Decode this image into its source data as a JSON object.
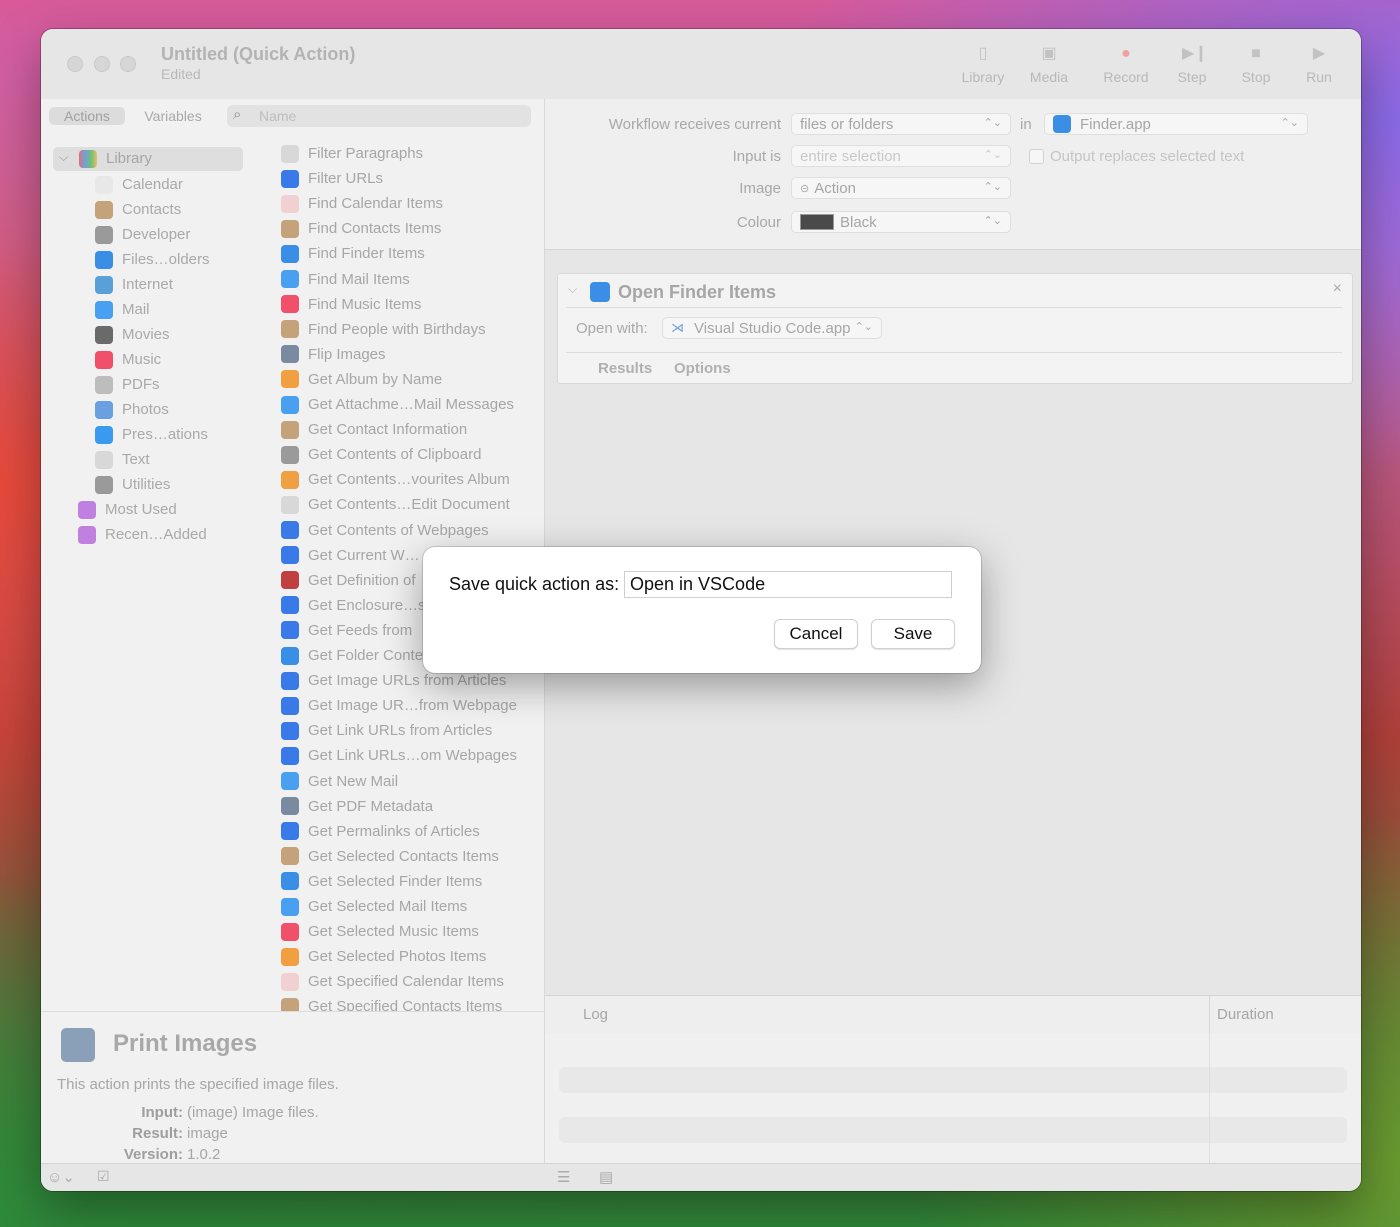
{
  "window": {
    "title": "Untitled (Quick Action)",
    "subtitle": "Edited"
  },
  "toolbar": {
    "items": [
      {
        "label": "Library",
        "icon": "library-icon"
      },
      {
        "label": "Media",
        "icon": "media-icon"
      },
      {
        "label": "Record",
        "icon": "record-icon"
      },
      {
        "label": "Step",
        "icon": "step-icon"
      },
      {
        "label": "Stop",
        "icon": "stop-icon"
      },
      {
        "label": "Run",
        "icon": "run-icon"
      }
    ]
  },
  "left": {
    "tabs": [
      "Actions",
      "Variables"
    ],
    "search_placeholder": "Name",
    "library_label": "Library",
    "library": [
      {
        "label": "Calendar",
        "color": "#e8e8e8"
      },
      {
        "label": "Contacts",
        "color": "#c4a27a"
      },
      {
        "label": "Developer",
        "color": "#9a9a9a"
      },
      {
        "label": "Files…olders",
        "color": "#3a8ee6"
      },
      {
        "label": "Internet",
        "color": "#5aa0d8"
      },
      {
        "label": "Mail",
        "color": "#4aa0f0"
      },
      {
        "label": "Movies",
        "color": "#6a6a6a"
      },
      {
        "label": "Music",
        "color": "#f0506a"
      },
      {
        "label": "PDFs",
        "color": "#bdbdbd"
      },
      {
        "label": "Photos",
        "color": "#6aa0e0"
      },
      {
        "label": "Pres…ations",
        "color": "#3a9af0"
      },
      {
        "label": "Text",
        "color": "#d8d8d8"
      },
      {
        "label": "Utilities",
        "color": "#9a9a9a"
      }
    ],
    "smart": [
      {
        "label": "Most Used",
        "color": "#c080e0"
      },
      {
        "label": "Recen…Added",
        "color": "#c080e0"
      }
    ],
    "actions": [
      {
        "label": "Filter Paragraphs",
        "color": "#d8d8d8"
      },
      {
        "label": "Filter URLs",
        "color": "#3a7ae8"
      },
      {
        "label": "Find Calendar Items",
        "color": "#f0d0d0"
      },
      {
        "label": "Find Contacts Items",
        "color": "#c4a27a"
      },
      {
        "label": "Find Finder Items",
        "color": "#3a8ee6"
      },
      {
        "label": "Find Mail Items",
        "color": "#4aa0f0"
      },
      {
        "label": "Find Music Items",
        "color": "#f0506a"
      },
      {
        "label": "Find People with Birthdays",
        "color": "#c4a27a"
      },
      {
        "label": "Flip Images",
        "color": "#7a8aa0"
      },
      {
        "label": "Get Album by Name",
        "color": "#f0a040"
      },
      {
        "label": "Get Attachme…Mail Messages",
        "color": "#4aa0f0"
      },
      {
        "label": "Get Contact Information",
        "color": "#c4a27a"
      },
      {
        "label": "Get Contents of Clipboard",
        "color": "#9a9a9a"
      },
      {
        "label": "Get Contents…vourites Album",
        "color": "#f0a040"
      },
      {
        "label": "Get Contents…Edit Document",
        "color": "#d8d8d8"
      },
      {
        "label": "Get Contents of Webpages",
        "color": "#3a7ae8"
      },
      {
        "label": "Get Current W…",
        "color": "#3a7ae8"
      },
      {
        "label": "Get Definition of",
        "color": "#c04040"
      },
      {
        "label": "Get Enclosure…s",
        "color": "#3a7ae8"
      },
      {
        "label": "Get Feeds from",
        "color": "#3a7ae8"
      },
      {
        "label": "Get Folder Conte",
        "color": "#3a8ee6"
      },
      {
        "label": "Get Image URLs from Articles",
        "color": "#3a7ae8"
      },
      {
        "label": "Get Image UR…from Webpage",
        "color": "#3a7ae8"
      },
      {
        "label": "Get Link URLs from Articles",
        "color": "#3a7ae8"
      },
      {
        "label": "Get Link URLs…om Webpages",
        "color": "#3a7ae8"
      },
      {
        "label": "Get New Mail",
        "color": "#4aa0f0"
      },
      {
        "label": "Get PDF Metadata",
        "color": "#7a8aa0"
      },
      {
        "label": "Get Permalinks of Articles",
        "color": "#3a7ae8"
      },
      {
        "label": "Get Selected Contacts Items",
        "color": "#c4a27a"
      },
      {
        "label": "Get Selected Finder Items",
        "color": "#3a8ee6"
      },
      {
        "label": "Get Selected Mail Items",
        "color": "#4aa0f0"
      },
      {
        "label": "Get Selected Music Items",
        "color": "#f0506a"
      },
      {
        "label": "Get Selected Photos Items",
        "color": "#f0a040"
      },
      {
        "label": "Get Specified Calendar Items",
        "color": "#f0d0d0"
      },
      {
        "label": "Get Specified Contacts Items",
        "color": "#c4a27a"
      }
    ],
    "description": {
      "title": "Print Images",
      "text": "This action prints the specified image files.",
      "input_label": "Input:",
      "input_value": "(image) Image files.",
      "result_label": "Result:",
      "result_value": "image",
      "version_label": "Version:",
      "version_value": "1.0.2"
    }
  },
  "workflow": {
    "receives_label": "Workflow receives current",
    "receives_value": "files or folders",
    "in_label": "in",
    "app_value": "Finder.app",
    "input_is_label": "Input is",
    "input_is_value": "entire selection",
    "output_replaces_label": "Output replaces selected text",
    "image_label": "Image",
    "image_value": "Action",
    "colour_label": "Colour",
    "colour_value": "Black",
    "colour_swatch": "#4a4a4a"
  },
  "action_card": {
    "title": "Open Finder Items",
    "open_with_label": "Open with:",
    "open_with_value": "Visual Studio Code.app",
    "tabs": [
      "Results",
      "Options"
    ]
  },
  "log": {
    "log_label": "Log",
    "duration_label": "Duration"
  },
  "dialog": {
    "label": "Save quick action as:",
    "value": "Open in VSCode",
    "cancel": "Cancel",
    "save": "Save"
  }
}
